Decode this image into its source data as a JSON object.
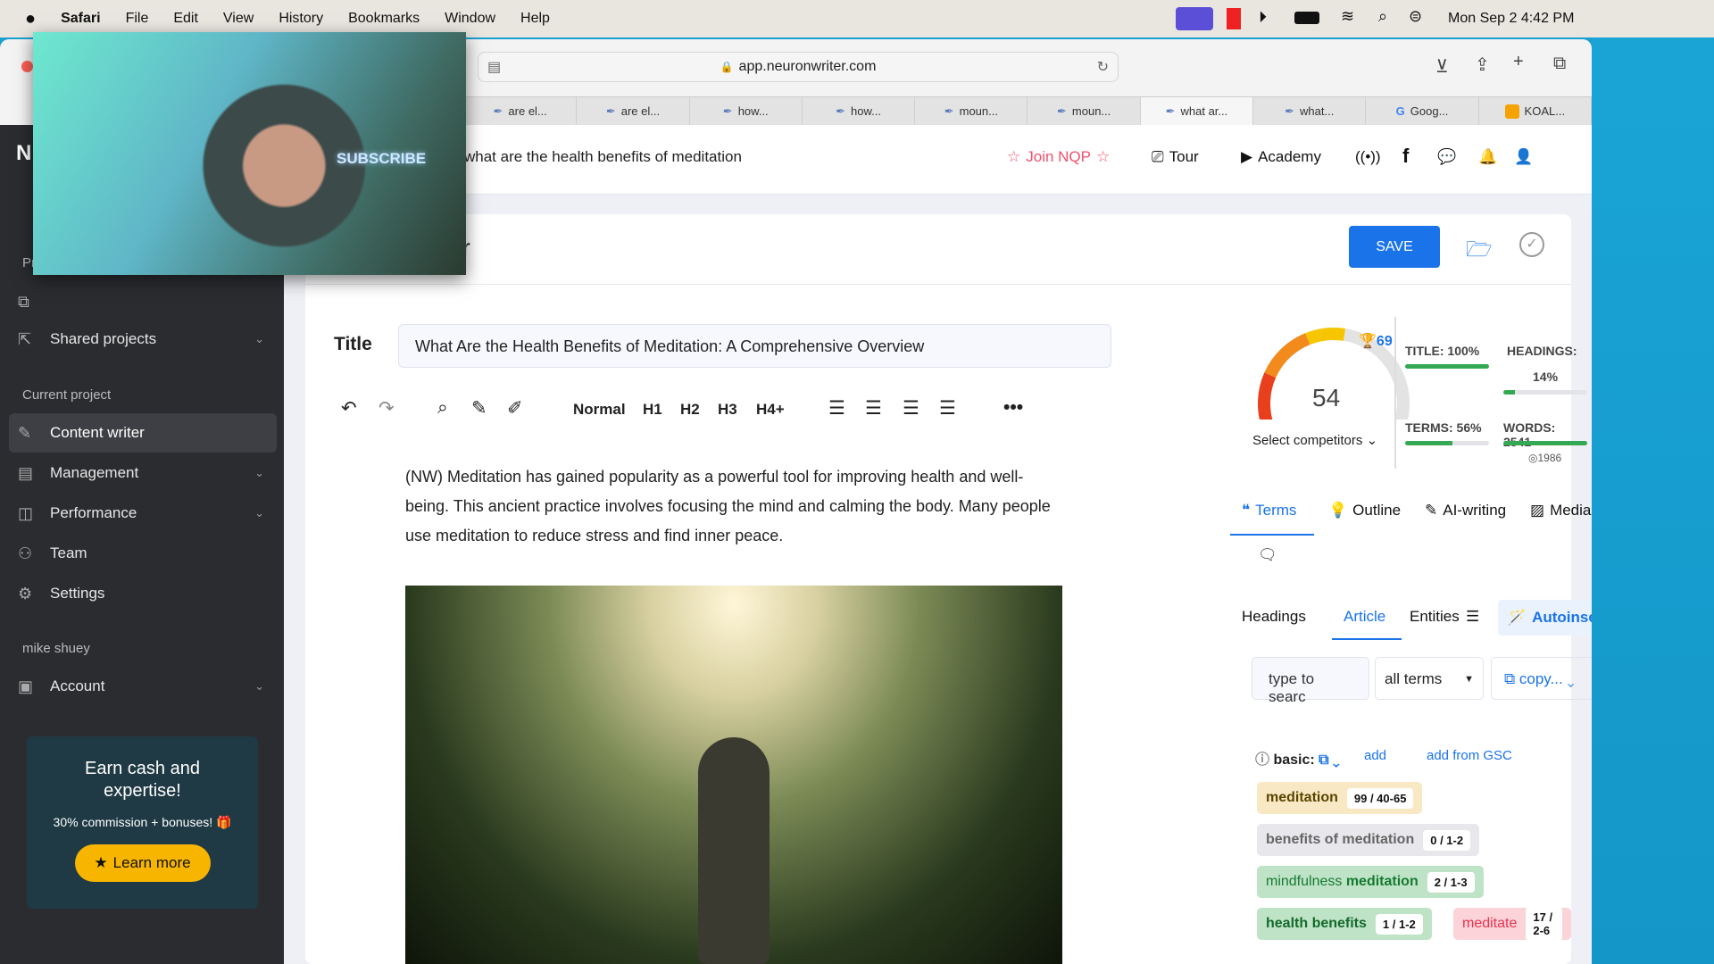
{
  "menubar": {
    "app": "Safari",
    "items": [
      "File",
      "Edit",
      "View",
      "History",
      "Bookmarks",
      "Window",
      "Help"
    ],
    "clock": "Mon Sep 2  4:42 PM"
  },
  "browser": {
    "url": "app.neuronwriter.com",
    "tabs": [
      {
        "label": "are el..."
      },
      {
        "label": "are el..."
      },
      {
        "label": "how..."
      },
      {
        "label": "how..."
      },
      {
        "label": "moun..."
      },
      {
        "label": "moun..."
      },
      {
        "label": "what ar...",
        "active": true
      },
      {
        "label": "what..."
      },
      {
        "label": "Goog..."
      },
      {
        "label": "KOAL..."
      }
    ]
  },
  "webcam": {
    "sign": "SUBSCRIBE"
  },
  "sidebar": {
    "logo": "N",
    "section_prefix": "Pr",
    "shared_projects": "Shared projects",
    "current_project_heading": "Current project",
    "items": [
      {
        "label": "Content writer",
        "active": true
      },
      {
        "label": "Management"
      },
      {
        "label": "Performance"
      },
      {
        "label": "Team"
      },
      {
        "label": "Settings"
      }
    ],
    "user": "mike shuey",
    "account": "Account",
    "promo": {
      "title": "Earn cash and expertise!",
      "subtitle": "30% commission + bonuses! 🎁",
      "button": "Learn more"
    }
  },
  "header": {
    "query": "what are the health benefits of meditation",
    "join": "Join NQP",
    "tour": "Tour",
    "academy": "Academy"
  },
  "editor": {
    "partial_title": "r",
    "save": "SAVE",
    "title_label": "Title",
    "title_value": "What Are the Health Benefits of Meditation: A Comprehensive Overview",
    "toolbar": {
      "normal": "Normal",
      "h1": "H1",
      "h2": "H2",
      "h3": "H3",
      "h4": "H4+"
    },
    "paragraph": "(NW) Meditation has gained popularity as a powerful tool for improving health and well-being. This ancient practice involves focusing the mind and calming the body. Many people use meditation to reduce stress and find inner peace."
  },
  "score": {
    "value": "54",
    "target": "69",
    "select_competitors": "Select competitors",
    "title": {
      "label": "TITLE: 100%",
      "pct": 100
    },
    "headings": {
      "label": "HEADINGS:",
      "value": "14%",
      "pct": 14
    },
    "terms": {
      "label": "TERMS: 56%",
      "pct": 56
    },
    "words": {
      "label": "WORDS: 2541",
      "pct": 100,
      "target": "1986"
    },
    "colors": {
      "red": "#e8401c",
      "orange": "#f28a1c",
      "yellow": "#f7c600",
      "empty": "#e3e3e3"
    }
  },
  "panel": {
    "tabs": [
      "Terms",
      "Outline",
      "AI-writing",
      "Media"
    ],
    "subtabs": [
      "Headings",
      "Article",
      "Entities"
    ],
    "autoinsert": "Autoinsert",
    "search_placeholder": "type to searc",
    "filter": "all terms",
    "copy": "copy...",
    "basic": "basic:",
    "add": "add",
    "add_gsc": "add from GSC",
    "terms": [
      {
        "text": "meditation",
        "count": "99 / 40-65",
        "status": "over"
      },
      {
        "text": "benefits of meditation",
        "count": "0 / 1-2",
        "status": "missing"
      },
      {
        "pre": "mindfulness ",
        "text": "meditation",
        "count": "2 / 1-3",
        "status": "ok"
      },
      {
        "text": "health benefits",
        "count": "1 / 1-2",
        "status": "ok"
      },
      {
        "text": "meditate",
        "count": "17 / 2-6",
        "status": "over-red"
      }
    ]
  },
  "accent": "#1a73e8"
}
